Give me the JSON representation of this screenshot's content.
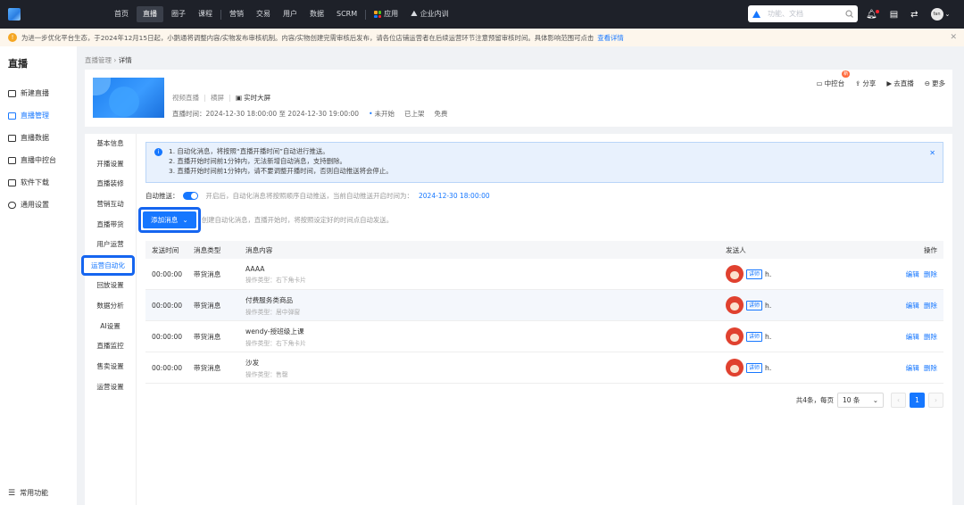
{
  "nav": {
    "items": [
      "首页",
      "直播",
      "圈子",
      "课程",
      "营销",
      "交易",
      "用户",
      "数据",
      "SCRM"
    ],
    "active": "直播",
    "apps_label": "应用",
    "enterprise_label": "企业内训",
    "search_placeholder": "功能、文档",
    "avatar_label": "fan"
  },
  "notice": {
    "text": "为进一步优化平台生态，于2024年12月15日起，小鹅通将调整内容/实物发布审核机制。内容/实物创建完需审核后发布，请各位店铺运营者在后续运营环节注意预留审核时间。具体影响范围可点击",
    "link": "查看详情"
  },
  "sidebar": {
    "title": "直播",
    "items": [
      "新建直播",
      "直播管理",
      "直播数据",
      "直播中控台",
      "软件下载",
      "通用设置"
    ],
    "active_index": 1,
    "bottom": "常用功能"
  },
  "breadcrumb": {
    "parent": "直播管理",
    "current": "详情"
  },
  "header": {
    "type": "视频直播",
    "orientation": "横屏",
    "screen": "实时大屏",
    "time_label": "直播时间：",
    "time_value": "2024-12-30 18:00:00 至 2024-12-30 19:00:00",
    "status": "未开始",
    "shelf": "已上架",
    "price": "免费",
    "actions": {
      "control": "中控台",
      "control_badge": "新",
      "share": "分享",
      "go_live": "去直播",
      "more": "更多"
    }
  },
  "subnav": {
    "items": [
      "基本信息",
      "开播设置",
      "直播装修",
      "营销互动",
      "直播带货",
      "用户运营",
      "运营自动化",
      "回放设置",
      "数据分析",
      "AI设置",
      "直播监控",
      "售卖设置",
      "运营设置"
    ],
    "active_index": 6
  },
  "info": {
    "lines": [
      "1. 自动化消息，将按照“直播开播时间”自动进行推送。",
      "2. 直播开始时间前1分钟内，无法新增自动消息，支持删除。",
      "3. 直播开始时间前1分钟内，请不要调整开播时间，否则自动推送将会停止。"
    ]
  },
  "auto_push": {
    "label": "自动推送：",
    "hint": "开启后，自动化消息将按照顺序自动推送，当前自动推送开启时间为：",
    "time": "2024-12-30 18:00:00",
    "enabled": true
  },
  "add": {
    "button": "添加消息",
    "hint": "创建自动化消息，直播开始时，将按照设定好的时间点自动发送。"
  },
  "table": {
    "headers": [
      "发送时间",
      "消息类型",
      "消息内容",
      "发送人",
      "操作"
    ],
    "rows": [
      {
        "time": "00:00:00",
        "type": "带货消息",
        "content": "AAAA",
        "sub": "操作类型：右下角卡片",
        "tag": "讲师",
        "sender": "h."
      },
      {
        "time": "00:00:00",
        "type": "带货消息",
        "content": "付费服务类商品",
        "sub": "操作类型：居中弹窗",
        "tag": "讲师",
        "sender": "h."
      },
      {
        "time": "00:00:00",
        "type": "带货消息",
        "content": "wendy-授班级上课",
        "sub": "操作类型：右下角卡片",
        "tag": "讲师",
        "sender": "h."
      },
      {
        "time": "00:00:00",
        "type": "带货消息",
        "content": "沙发",
        "sub": "操作类型：售罄",
        "tag": "讲师",
        "sender": "h."
      }
    ],
    "edit": "编辑",
    "delete": "删除"
  },
  "pager": {
    "total": "共4条，每页",
    "page_size": "10 条",
    "current_page": "1",
    "prev": "‹",
    "next": "›"
  },
  "colors": {
    "accent": "#1677ff",
    "topbar": "#1e2129",
    "highlight_border": "#1565f0"
  }
}
